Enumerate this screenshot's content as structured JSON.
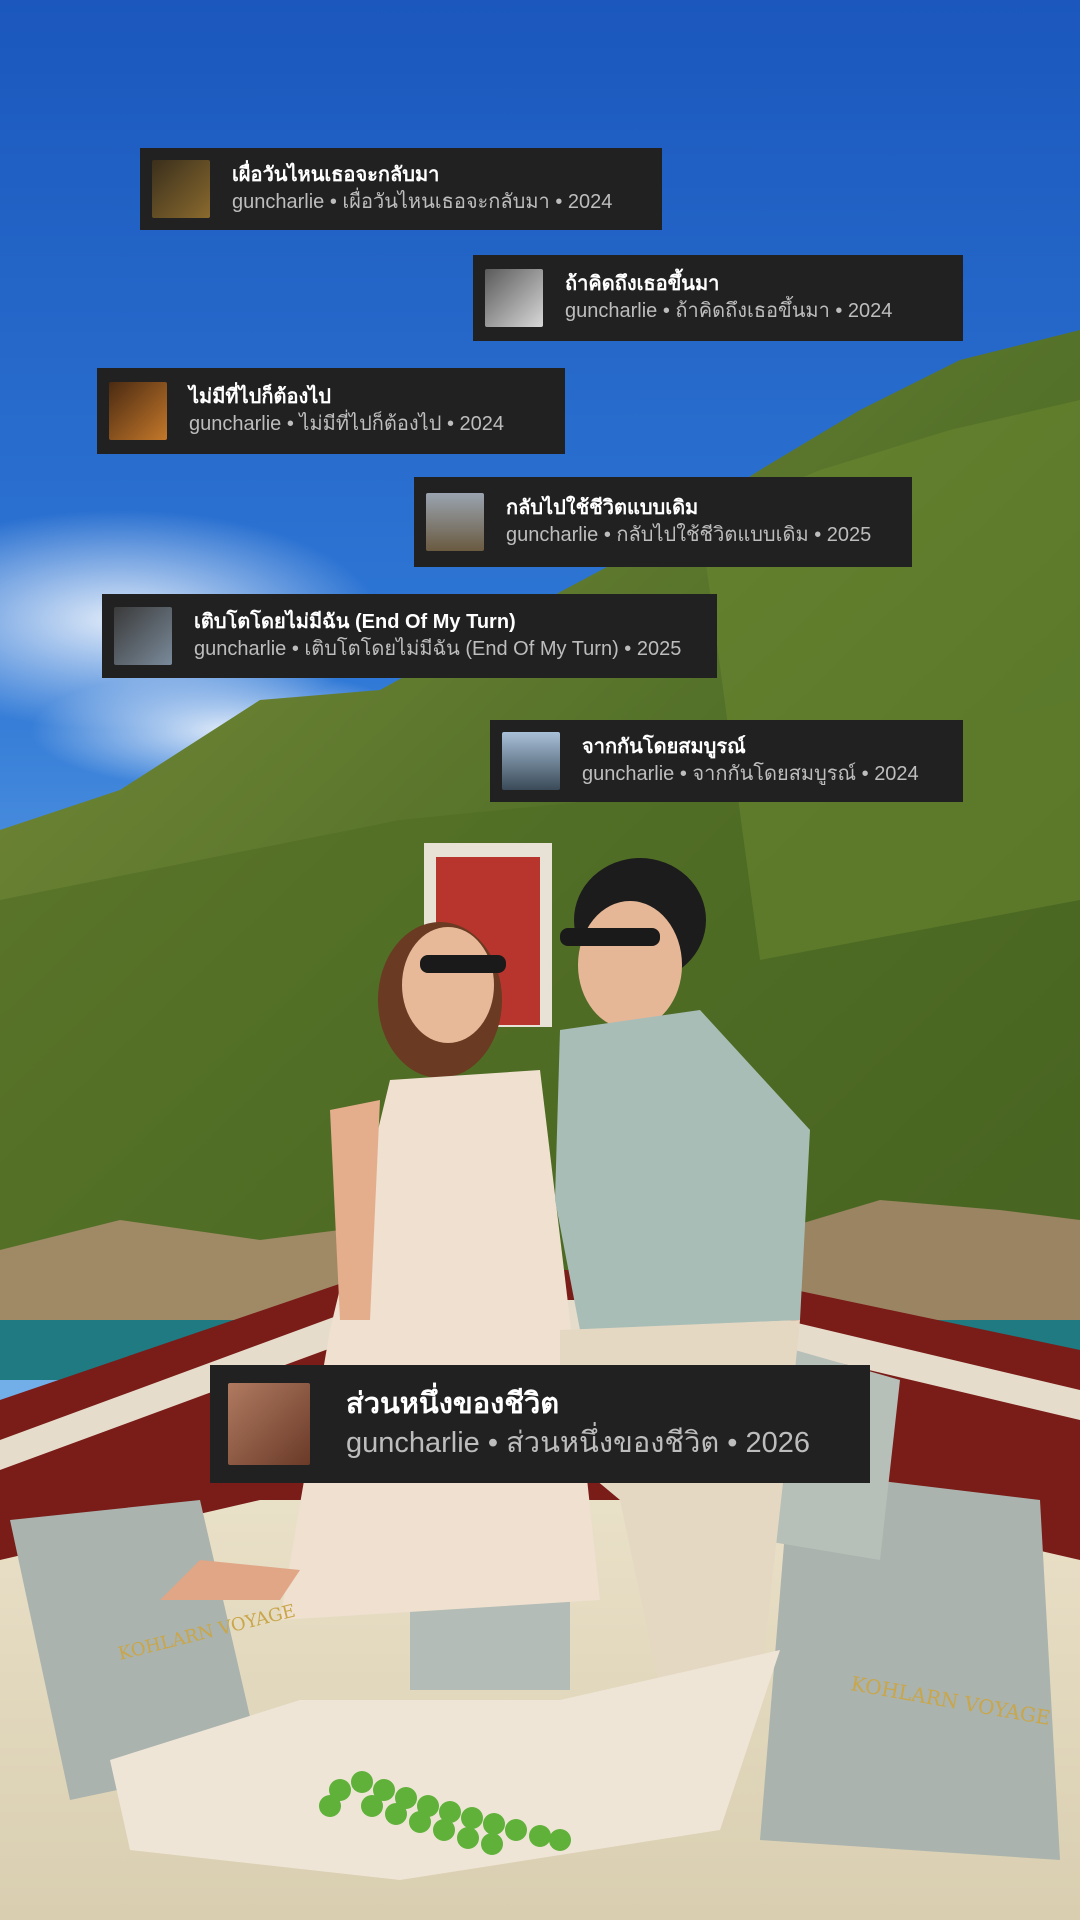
{
  "cards": [
    {
      "title": "เผื่อวันไหนเธอจะกลับมา",
      "subtitle": "guncharlie • เผื่อวันไหนเธอจะกลับมา • 2024",
      "thumb_colors": [
        "#3a2f1c",
        "#8a6a2e"
      ]
    },
    {
      "title": "ถ้าคิดถึงเธอขึ้นมา",
      "subtitle": "guncharlie • ถ้าคิดถึงเธอขึ้นมา • 2024",
      "thumb_colors": [
        "#5a5a5a",
        "#d8d8d8"
      ]
    },
    {
      "title": "ไม่มีที่ไปก็ต้องไป",
      "subtitle": "guncharlie • ไม่มีที่ไปก็ต้องไป • 2024",
      "thumb_colors": [
        "#4a2a12",
        "#c4782a"
      ]
    },
    {
      "title": "กลับไปใช้ชีวิตแบบเดิม",
      "subtitle": "guncharlie • กลับไปใช้ชีวิตแบบเดิม • 2025",
      "thumb_colors": [
        "#9aa4b0",
        "#6a5a40"
      ]
    },
    {
      "title": "เติบโตโดยไม่มีฉัน (End Of My Turn)",
      "subtitle": "guncharlie • เติบโตโดยไม่มีฉัน (End Of My Turn) • 2025",
      "thumb_colors": [
        "#3a3a3a",
        "#7a8a9a"
      ]
    },
    {
      "title": "จากกันโดยสมบูรณ์",
      "subtitle": "guncharlie • จากกันโดยสมบูรณ์ • 2024",
      "thumb_colors": [
        "#a8c0d8",
        "#3a4a58"
      ]
    }
  ],
  "featured": {
    "title": "ส่วนหนึ่งของชีวิต",
    "subtitle": "guncharlie • ส่วนหนึ่งของชีวิต • 2026",
    "thumb_colors": [
      "#b07a60",
      "#6a3a28"
    ]
  },
  "pillow_text": "KOHLARN VOYAGE",
  "colors": {
    "card_bg": "#212121",
    "card_title": "#ffffff",
    "card_subtitle": "#bdbdbd",
    "sky_top": "#1f5fc4",
    "sky_bottom": "#5d9ce6",
    "hill_green": "#5f7a2a",
    "boat_red": "#7a1c18"
  }
}
